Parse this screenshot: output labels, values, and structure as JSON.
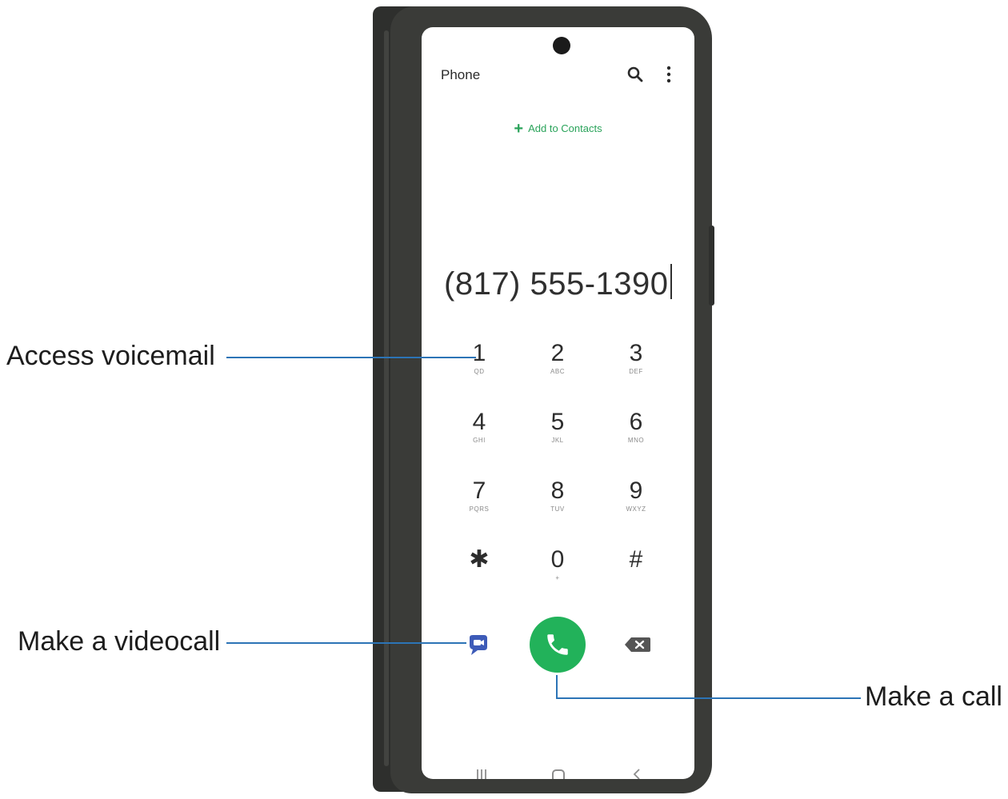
{
  "phone": {
    "app_title": "Phone",
    "add_to_contacts": "Add to Contacts",
    "dialed_number": "(817) 555-1390",
    "keypad": [
      {
        "digit": "1",
        "letters": "QD"
      },
      {
        "digit": "2",
        "letters": "ABC"
      },
      {
        "digit": "3",
        "letters": "DEF"
      },
      {
        "digit": "4",
        "letters": "GHI"
      },
      {
        "digit": "5",
        "letters": "JKL"
      },
      {
        "digit": "6",
        "letters": "MNO"
      },
      {
        "digit": "7",
        "letters": "PQRS"
      },
      {
        "digit": "8",
        "letters": "TUV"
      },
      {
        "digit": "9",
        "letters": "WXYZ"
      },
      {
        "digit": "✱",
        "letters": ""
      },
      {
        "digit": "0",
        "letters": "+"
      },
      {
        "digit": "#",
        "letters": ""
      }
    ],
    "icons": {
      "search": "search-icon",
      "more": "more-options-icon",
      "video": "videocall-icon",
      "call": "phone-call-icon",
      "backspace": "backspace-icon"
    },
    "colors": {
      "accent_green": "#22b25a",
      "video_blue": "#3d5bb8",
      "callout_line": "#2c74b6"
    }
  },
  "callouts": {
    "voicemail": "Access voicemail",
    "videocall": "Make a videocall",
    "call": "Make a call"
  }
}
